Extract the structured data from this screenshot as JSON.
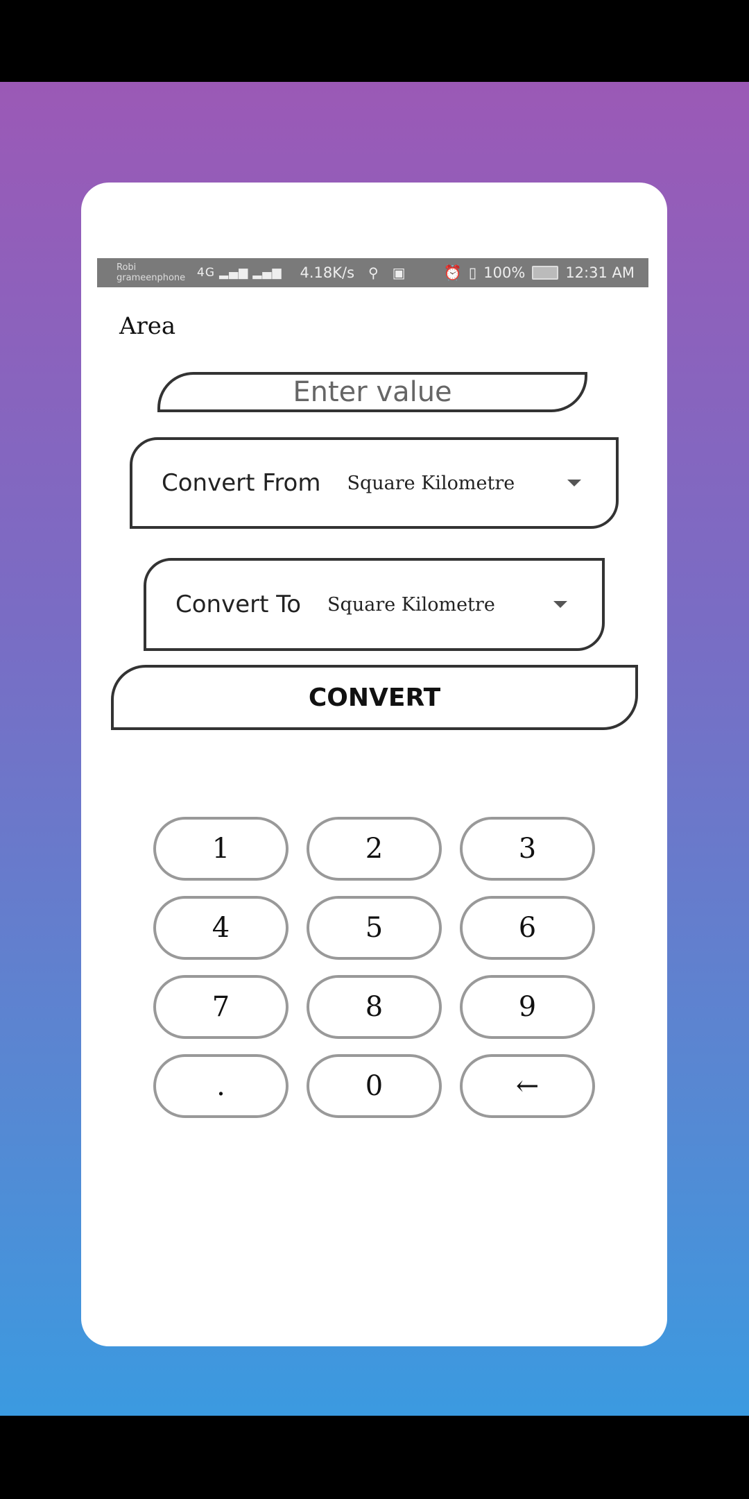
{
  "status_bar": {
    "carrier_1": "Robi",
    "carrier_2": "grameenphone",
    "network": "4G",
    "speed": "4.18K/s",
    "battery": "100%",
    "time": "12:31 AM"
  },
  "title": "Area",
  "value_input": {
    "placeholder": "Enter value",
    "value": ""
  },
  "convert_from": {
    "label": "Convert From",
    "value": "Square Kilometre"
  },
  "convert_to": {
    "label": "Convert To",
    "value": "Square Kilometre"
  },
  "convert_button": "CONVERT",
  "keypad": {
    "k1": "1",
    "k2": "2",
    "k3": "3",
    "k4": "4",
    "k5": "5",
    "k6": "6",
    "k7": "7",
    "k8": "8",
    "k9": "9",
    "dot": ".",
    "k0": "0",
    "backspace": "←"
  },
  "colors": {
    "gradient_top": "#9b59b6",
    "gradient_bottom": "#3b9ae0"
  }
}
